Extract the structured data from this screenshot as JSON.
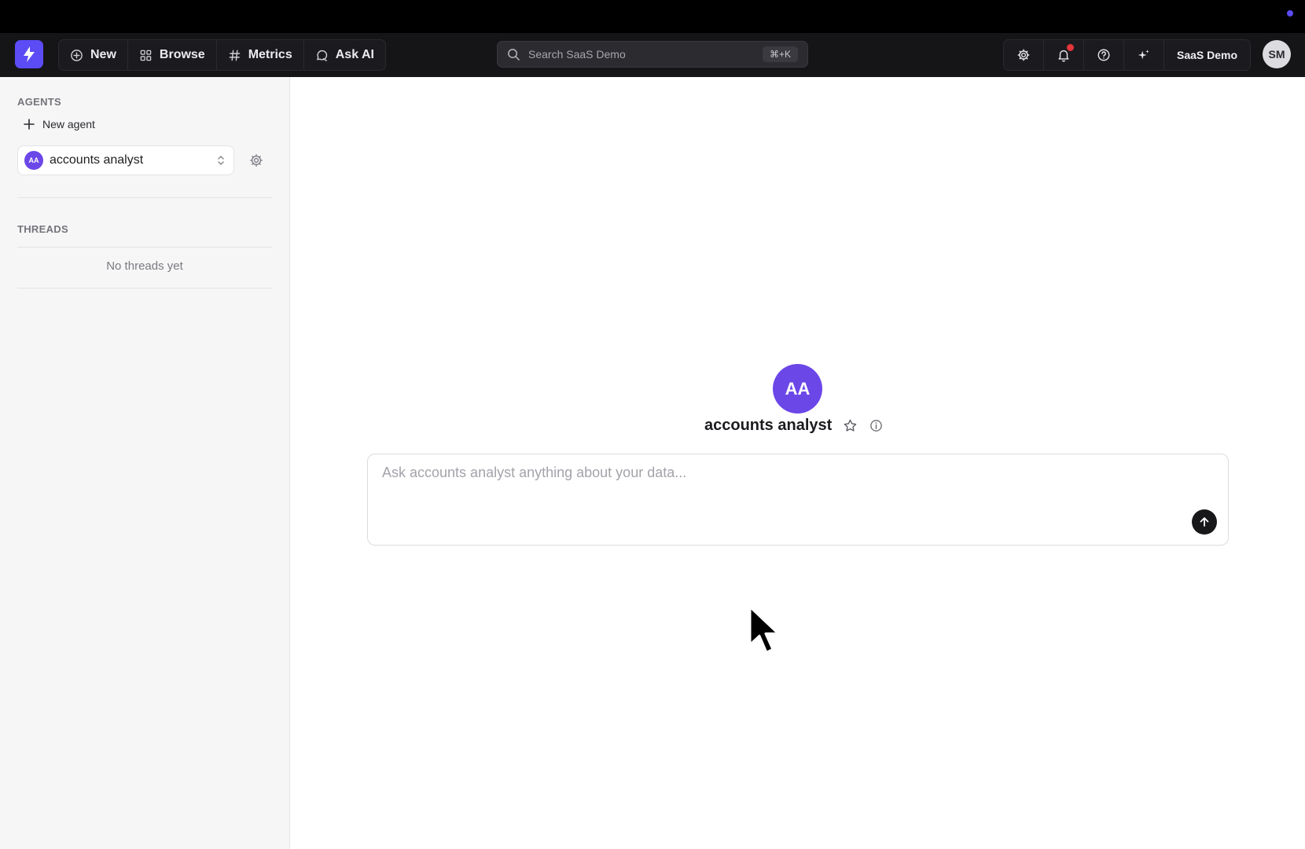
{
  "topnav": {
    "logo_icon": "bolt-icon",
    "items": [
      {
        "label": "New",
        "icon": "plus-circle-icon"
      },
      {
        "label": "Browse",
        "icon": "grid-icon"
      },
      {
        "label": "Metrics",
        "icon": "hash-icon"
      },
      {
        "label": "Ask AI",
        "icon": "chat-bubble-icon"
      }
    ],
    "search": {
      "placeholder": "Search SaaS Demo",
      "shortcut": "⌘+K"
    },
    "right_icons": [
      "gear-icon",
      "bell-icon",
      "help-icon",
      "sparkle-icon"
    ],
    "notification_dot": true,
    "workspace_label": "SaaS Demo",
    "user_initials": "SM"
  },
  "sidebar": {
    "agents_heading": "AGENTS",
    "new_agent_label": "New agent",
    "selected_agent": {
      "initials": "AA",
      "name": "accounts analyst"
    },
    "threads_heading": "THREADS",
    "empty_threads": "No threads yet"
  },
  "main": {
    "agent_initials": "AA",
    "agent_name": "accounts analyst",
    "prompt_placeholder": "Ask accounts analyst anything about your data...",
    "send_icon": "arrow-up-icon"
  },
  "colors": {
    "brand": "#5b4cf5",
    "agent_avatar": "#6c47e8",
    "topbar_bg": "#151517",
    "sidebar_bg": "#f6f6f7",
    "notification": "#e5343a"
  }
}
